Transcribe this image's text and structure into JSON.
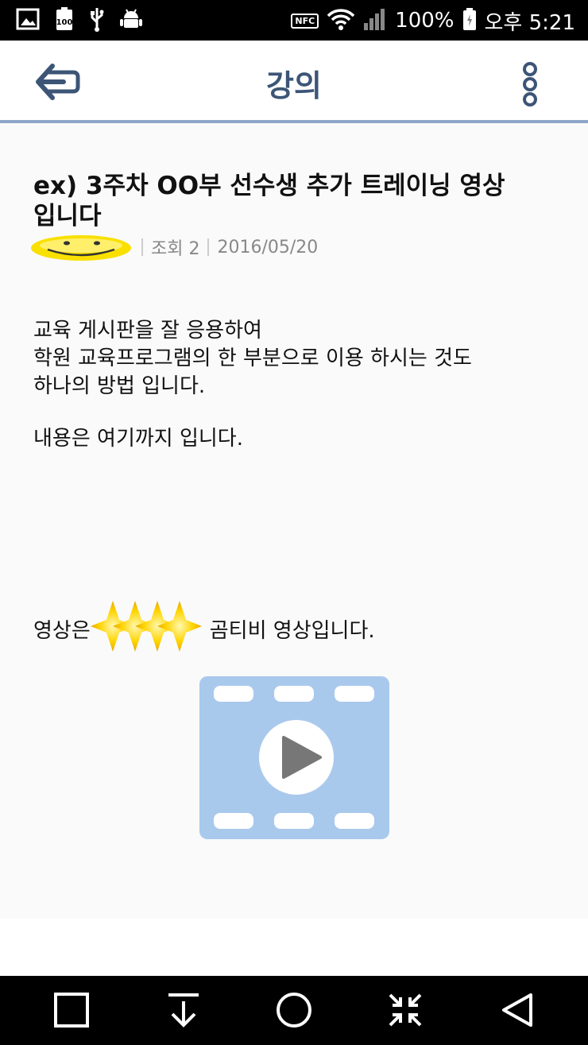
{
  "status_bar": {
    "icons": [
      "gallery-icon",
      "battery-100-icon",
      "usb-icon",
      "android-debug-icon",
      "nfc-icon",
      "wifi-icon",
      "signal-icon",
      "battery-icon"
    ],
    "nfc_label": "NFC",
    "battery_percent": "100%",
    "time": "오후 5:21"
  },
  "app_bar": {
    "title": "강의",
    "back_icon": "arrow-left-icon",
    "menu_icon": "more-vertical-icon"
  },
  "post": {
    "title": "ex) 3주차 OO부 선수생 추가 트레이닝 영상 입니다",
    "views": "조회 2",
    "date": "2016/05/20",
    "body": "교육 게시판을 잘 응용하여\n학원 교육프로그램의 한 부분으로 이용 하시는 것도\n하나의 방법 입니다.",
    "body_end": "내용은 여기까지 입니다.",
    "video_caption_prefix": "영상은",
    "video_caption_suffix": "곰티비 영상입니다."
  },
  "nav_bar": {
    "icons": [
      "square-icon",
      "download-icon",
      "home-circle-icon",
      "collapse-icon",
      "back-triangle-icon"
    ]
  },
  "colors": {
    "accent": "#3c5577",
    "divider": "#8ea6c9",
    "video_blue": "#a9c9ec"
  }
}
